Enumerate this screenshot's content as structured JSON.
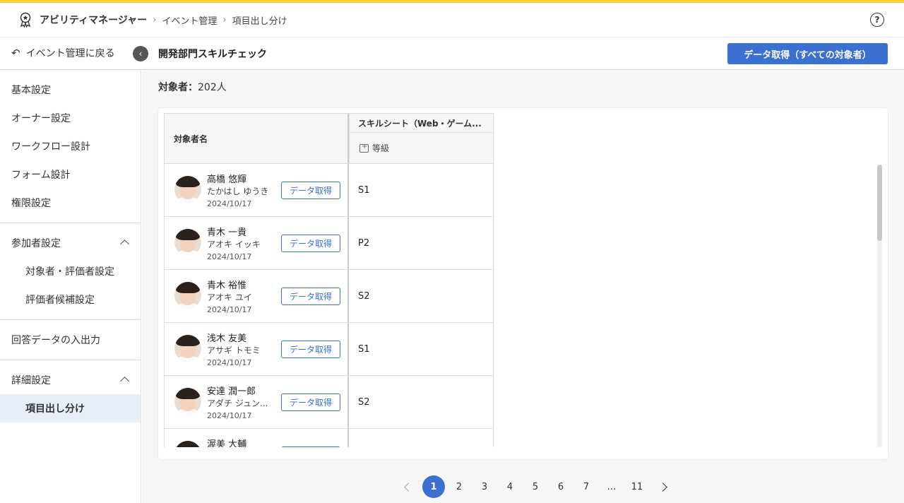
{
  "header": {
    "app_title": "アビリティマネージャー",
    "breadcrumbs": [
      "イベント管理",
      "項目出し分け"
    ],
    "help_symbol": "?"
  },
  "subbar": {
    "back_label": "イベント管理に戻る",
    "title": "開発部門スキルチェック",
    "primary_button": "データ取得（すべての対象者）"
  },
  "sidebar": {
    "items": [
      {
        "label": "基本設定"
      },
      {
        "label": "オーナー設定"
      },
      {
        "label": "ワークフロー設計"
      },
      {
        "label": "フォーム設計"
      },
      {
        "label": "権限設定"
      }
    ],
    "participant_section": "参加者設定",
    "participant_items": [
      {
        "label": "対象者・評価者設定"
      },
      {
        "label": "評価者候補設定"
      }
    ],
    "answer_io": "回答データの入出力",
    "detail_section": "詳細設定",
    "detail_items": [
      {
        "label": "項目出し分け"
      }
    ]
  },
  "main": {
    "count_label": "対象者：",
    "count_value": "202人"
  },
  "table": {
    "col_name": "対象者名",
    "col_skill": "スキルシート（Web・ゲーム...",
    "col_grade": "等級",
    "rows": [
      {
        "name": "高橋 悠輝",
        "kana": "たかはし ゆうき",
        "date": "2024/10/17",
        "button": "データ取得",
        "grade": "S1"
      },
      {
        "name": "青木 一貴",
        "kana": "アオキ イッキ",
        "date": "2024/10/17",
        "button": "データ取得",
        "grade": "P2"
      },
      {
        "name": "青木 裕惟",
        "kana": "アオキ ユイ",
        "date": "2024/10/17",
        "button": "データ取得",
        "grade": "S2"
      },
      {
        "name": "浅木 友美",
        "kana": "アサギ トモミ",
        "date": "2024/10/17",
        "button": "データ取得",
        "grade": "S1"
      },
      {
        "name": "安達 潤一郎",
        "kana": "アダチ ジュン...",
        "date": "2024/10/17",
        "button": "データ取得",
        "grade": "S2"
      },
      {
        "name": "渥美 大輔",
        "kana": "",
        "date": "",
        "button": "",
        "grade": ""
      }
    ]
  },
  "pagination": {
    "pages": [
      "1",
      "2",
      "3",
      "4",
      "5",
      "6",
      "7",
      "…",
      "11"
    ],
    "current": "1"
  }
}
